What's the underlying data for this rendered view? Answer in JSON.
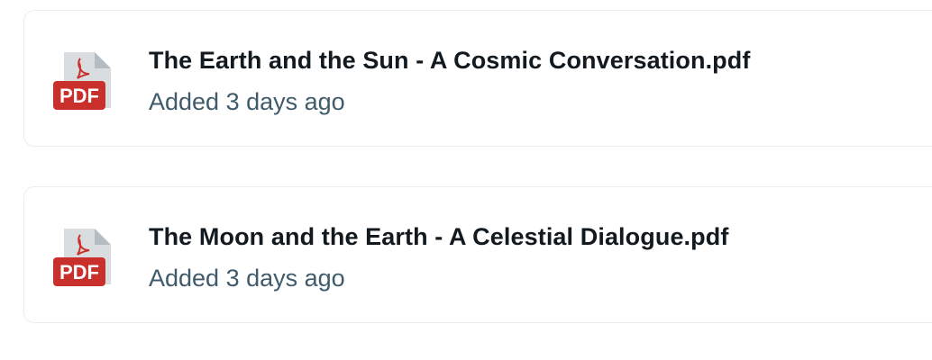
{
  "files": [
    {
      "name": "The Earth and the Sun - A Cosmic Conversation.pdf",
      "meta": "Added 3 days ago",
      "icon": "pdf-file-icon",
      "badge": "PDF"
    },
    {
      "name": "The Moon and the Earth - A Celestial Dialogue.pdf",
      "meta": "Added 3 days ago",
      "icon": "pdf-file-icon",
      "badge": "PDF"
    }
  ],
  "colors": {
    "badge_red": "#c9302c",
    "page_grey": "#d9dde0",
    "fold_grey": "#b4bcc2",
    "title_text": "#121a20",
    "meta_text": "#3f5b6b",
    "card_border": "#ececec"
  }
}
